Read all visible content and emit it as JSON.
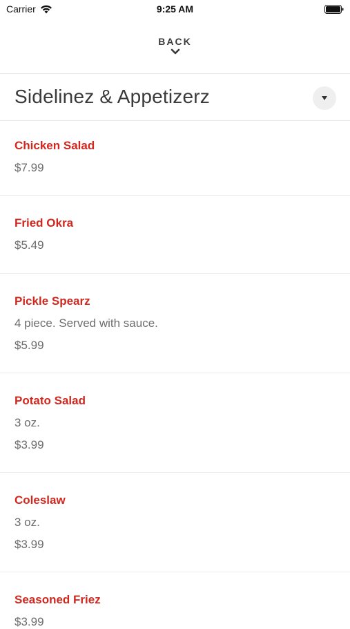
{
  "status_bar": {
    "carrier": "Carrier",
    "time": "9:25 AM"
  },
  "nav": {
    "back_label": "BACK"
  },
  "category": {
    "title": "Sidelinez & Appetizerz"
  },
  "items": [
    {
      "name": "Chicken Salad",
      "description": "",
      "price": "$7.99"
    },
    {
      "name": "Fried Okra",
      "description": "",
      "price": "$5.49"
    },
    {
      "name": "Pickle Spearz",
      "description": "4 piece. Served with sauce.",
      "price": "$5.99"
    },
    {
      "name": "Potato Salad",
      "description": "3 oz.",
      "price": "$3.99"
    },
    {
      "name": "Coleslaw",
      "description": "3 oz.",
      "price": "$3.99"
    },
    {
      "name": "Seasoned Friez",
      "description": "",
      "price": "$3.99"
    }
  ],
  "colors": {
    "item_name": "#d0281f",
    "secondary_text": "#6d6d6d",
    "divider": "#e6e6e6"
  }
}
